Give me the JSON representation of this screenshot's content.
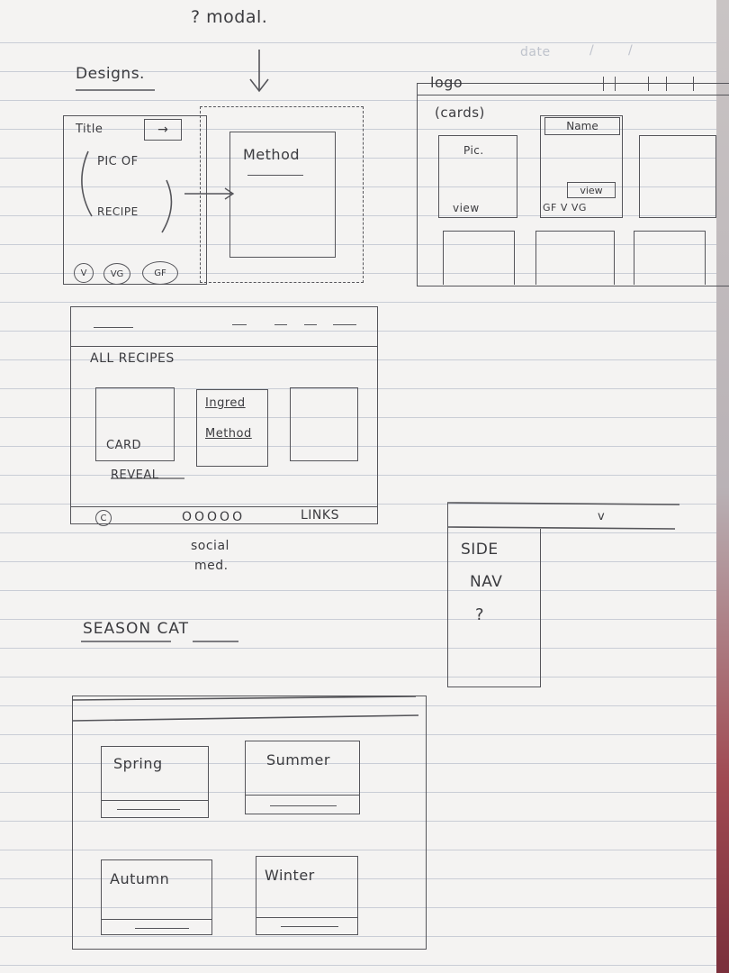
{
  "header": {
    "date_label": "date",
    "modal_note": "? modal.",
    "designs_heading": "Designs."
  },
  "recipe_sketch": {
    "title_label": "Title",
    "pic_text_1": "PIC OF",
    "pic_text_2": "RECIPE",
    "modal_method": "Method",
    "badges": [
      "V",
      "VG",
      "GF"
    ]
  },
  "logo_sketch": {
    "logo_label": "logo",
    "cards_label": "(cards)",
    "card1_pic": "Pic.",
    "card1_view": "view",
    "card2_name": "Name",
    "card2_view": "view",
    "card2_tags": "GF V VG"
  },
  "all_recipes_sketch": {
    "heading": "ALL RECIPES",
    "card_label": "CARD",
    "reveal_label": "REVEAL",
    "ingred_label": "Ingred",
    "method_label": "Method",
    "footer_copyright": "C",
    "footer_dots": "OOOOO",
    "footer_links": "LINKS",
    "social_1": "social",
    "social_2": "med."
  },
  "sidenav_sketch": {
    "chevron": "v",
    "line1": "SIDE",
    "line2": "NAV",
    "question": "?"
  },
  "season_sketch": {
    "heading": "SEASON CAT",
    "seasons": [
      "Spring",
      "Summer",
      "Autumn",
      "Winter"
    ]
  }
}
